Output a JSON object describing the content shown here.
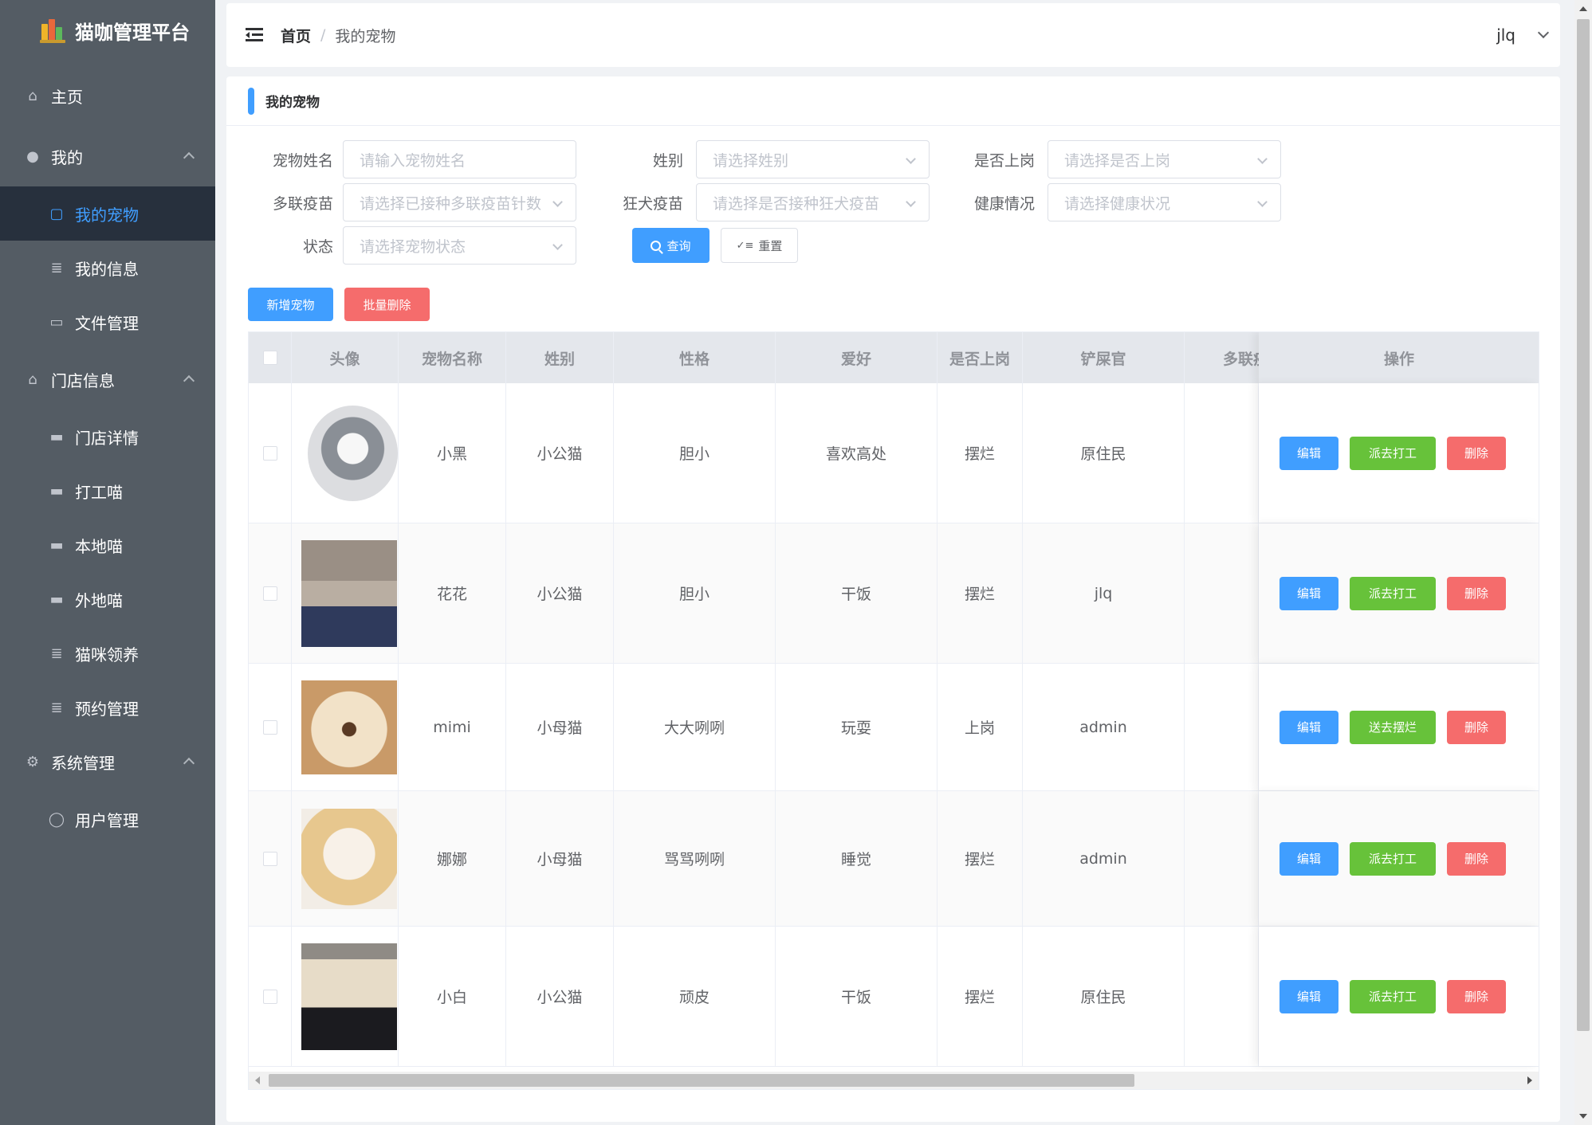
{
  "brand": {
    "title": "猫咖管理平台"
  },
  "sidebar": {
    "items": [
      {
        "label": "主页",
        "icon": "home-icon"
      },
      {
        "label": "我的",
        "icon": "user-icon"
      },
      {
        "label": "我的宠物",
        "icon": "badge-icon",
        "active": true
      },
      {
        "label": "我的信息",
        "icon": "document-icon"
      },
      {
        "label": "文件管理",
        "icon": "folder-icon"
      },
      {
        "label": "门店信息",
        "icon": "shop-icon"
      },
      {
        "label": "门店详情",
        "icon": "monitor-icon"
      },
      {
        "label": "打工喵",
        "icon": "monitor-icon"
      },
      {
        "label": "本地喵",
        "icon": "monitor-icon"
      },
      {
        "label": "外地喵",
        "icon": "monitor-icon"
      },
      {
        "label": "猫咪领养",
        "icon": "document-icon"
      },
      {
        "label": "预约管理",
        "icon": "document-icon"
      },
      {
        "label": "系统管理",
        "icon": "gear-icon"
      },
      {
        "label": "用户管理",
        "icon": "user-outline-icon"
      }
    ]
  },
  "header": {
    "breadcrumb_home": "首页",
    "breadcrumb_sep": "/",
    "breadcrumb_current": "我的宠物",
    "username": "jlq"
  },
  "card": {
    "title": "我的宠物"
  },
  "filters": {
    "pet_name": {
      "label": "宠物姓名",
      "placeholder": "请输入宠物姓名"
    },
    "gender": {
      "label": "姓别",
      "placeholder": "请选择姓别"
    },
    "on_duty": {
      "label": "是否上岗",
      "placeholder": "请选择是否上岗"
    },
    "multi_vaccine": {
      "label": "多联疫苗",
      "placeholder": "请选择已接种多联疫苗针数"
    },
    "rabies_vaccine": {
      "label": "狂犬疫苗",
      "placeholder": "请选择是否接种狂犬疫苗"
    },
    "health": {
      "label": "健康情况",
      "placeholder": "请选择健康状况"
    },
    "status": {
      "label": "状态",
      "placeholder": "请选择宠物状态"
    }
  },
  "buttons": {
    "query": "查询",
    "reset": "重置",
    "add": "新增宠物",
    "batch_delete": "批量删除"
  },
  "table": {
    "columns": [
      "头像",
      "宠物名称",
      "姓别",
      "性格",
      "爱好",
      "是否上岗",
      "铲屎官",
      "多联疫苗",
      "操作"
    ],
    "rows": [
      {
        "name": "小黑",
        "gender": "小公猫",
        "character": "胆小",
        "hobby": "喜欢高处",
        "on_duty": "摆烂",
        "owner": "原住民",
        "action": "派去打工"
      },
      {
        "name": "花花",
        "gender": "小公猫",
        "character": "胆小",
        "hobby": "干饭",
        "on_duty": "摆烂",
        "owner": "jlq",
        "action": "派去打工"
      },
      {
        "name": "mimi",
        "gender": "小母猫",
        "character": "大大咧咧",
        "hobby": "玩耍",
        "on_duty": "上岗",
        "owner": "admin",
        "action": "送去摆烂"
      },
      {
        "name": "娜娜",
        "gender": "小母猫",
        "character": "骂骂咧咧",
        "hobby": "睡觉",
        "on_duty": "摆烂",
        "owner": "admin",
        "action": "派去打工"
      },
      {
        "name": "小白",
        "gender": "小公猫",
        "character": "顽皮",
        "hobby": "干饭",
        "on_duty": "摆烂",
        "owner": "原住民",
        "action": "派去打工"
      }
    ],
    "edit_label": "编辑",
    "delete_label": "删除"
  },
  "colors": {
    "sidebar_bg": "#545c64",
    "sidebar_active_bg": "#27303d",
    "primary": "#409eff",
    "danger": "#f56c6c",
    "success": "#67c23a"
  }
}
